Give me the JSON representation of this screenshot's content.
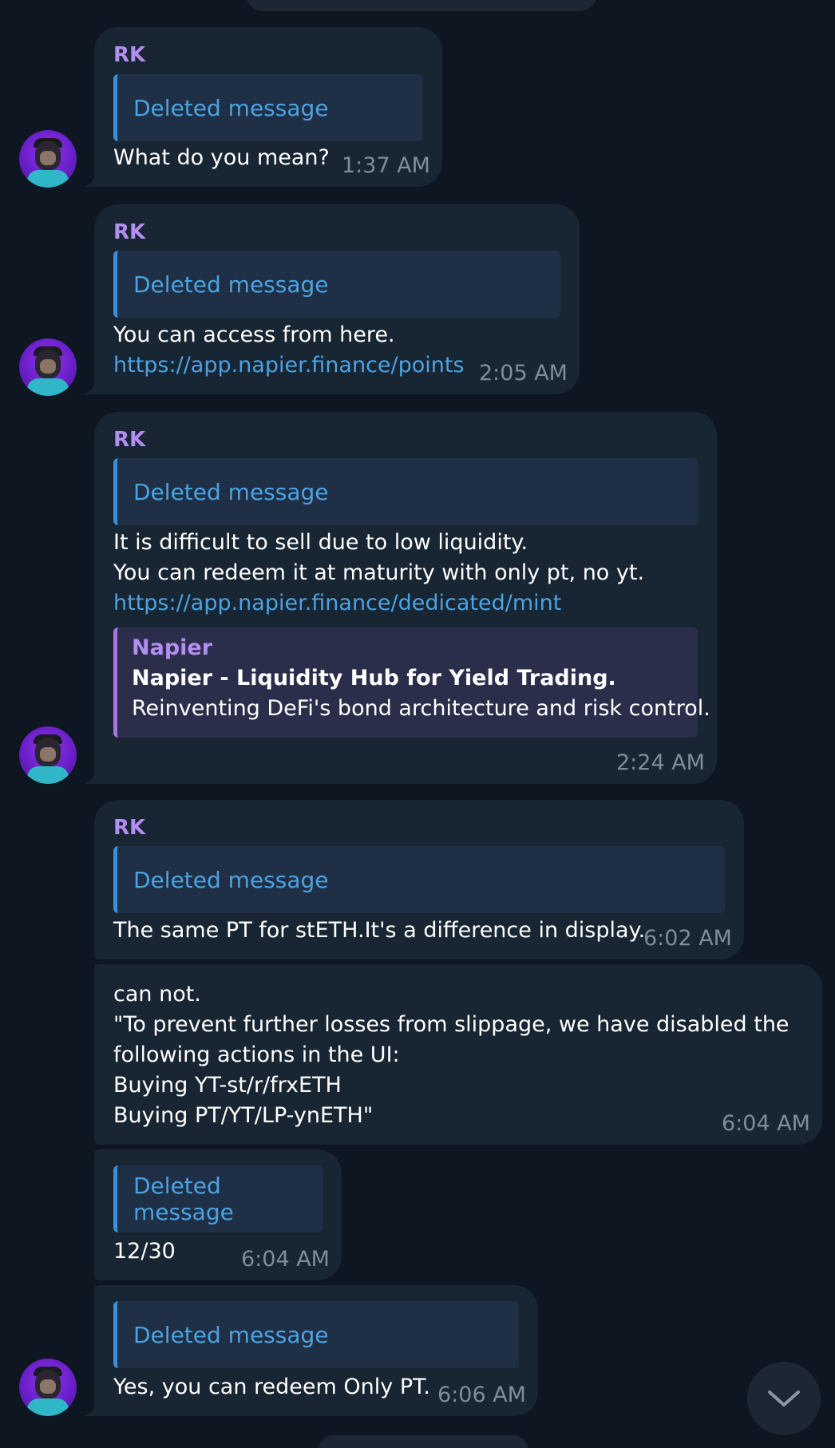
{
  "messages": [
    {
      "sender": "RK",
      "reply": "Deleted message",
      "lines": [
        "What do you mean?"
      ],
      "time": "1:37 AM"
    },
    {
      "sender": "RK",
      "reply": "Deleted message",
      "lines": [
        "You can access from here."
      ],
      "link": "https://app.napier.finance/points",
      "time": "2:05 AM"
    },
    {
      "sender": "RK",
      "reply": "Deleted message",
      "lines": [
        "It is difficult to sell due to low liquidity.",
        "You can redeem it at maturity with only pt, no yt."
      ],
      "link": "https://app.napier.finance/dedicated/mint",
      "preview": {
        "site": "Napier",
        "title": "Napier - Liquidity Hub for Yield Trading.",
        "description": "Reinventing DeFi's bond architecture and risk control."
      },
      "time": "2:24 AM"
    },
    {
      "sender": "RK",
      "reply": "Deleted message",
      "lines": [
        "The same PT for stETH.It's a difference in display."
      ],
      "time": "6:02 AM"
    },
    {
      "lines": [
        "can not.",
        "\"To prevent further losses from slippage, we have disabled the",
        "following actions in the UI:",
        "Buying YT-st/r/frxETH",
        "Buying PT/YT/LP-ynETH\""
      ],
      "time": "6:04 AM"
    },
    {
      "reply": "Deleted message",
      "lines": [
        "12/30"
      ],
      "time": "6:04 AM"
    },
    {
      "reply": "Deleted message",
      "lines": [
        "Yes, you can redeem Only PT."
      ],
      "time": "6:06 AM"
    }
  ],
  "colors": {
    "background": "#0e1621",
    "bubble": "#182533",
    "sender": "#b38ef0",
    "link": "#4ba3e3",
    "reply_bar": "#3a8fdc",
    "timestamp": "#7f8d9b"
  },
  "icons": {
    "scroll_down": "chevron-down-icon",
    "avatar": "ape-avatar"
  }
}
